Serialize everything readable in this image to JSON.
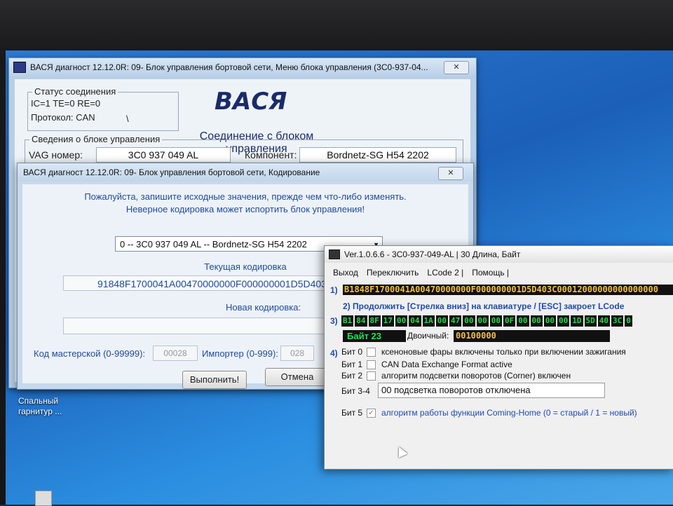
{
  "win1": {
    "title": "ВАСЯ диагност 12.12.0R: 09- Блок управления бортовой сети,  Меню блока управления (3C0-937-04...",
    "close": "✕",
    "status_group": "Статус соединения",
    "status_line": "IC=1  TE=0  RE=0",
    "protocol": "Протокол: CAN",
    "status_glyph": "\\",
    "brand": "ВАСЯ",
    "connection": "Соединение с блоком управления",
    "info_group": "Сведения о блоке управления",
    "vag_label": "VAG номер:",
    "vag_value": "3C0 937 049 AL",
    "component_label": "Компонент:",
    "component_value": "Bordnetz-SG     H54 2202"
  },
  "win2": {
    "title": "ВАСЯ диагност 12.12.0R: 09- Блок управления бортовой сети,  Кодирование",
    "close": "✕",
    "warning1": "Пожалуйста, запишите исходные значения, прежде чем что-либо изменять.",
    "warning2": "Неверное кодировка может испортить блок управления!",
    "combo_value": "0 -- 3C0 937 049 AL -- Bordnetz-SG     H54 2202",
    "current_label": "Текущая кодировка",
    "current_value": "91848F1700041A00470000000F000000001D5D403C0",
    "new_label": "Новая кодировка:",
    "workshop_label": "Код мастерской (0-99999):",
    "workshop_value": "00028",
    "importer_label": "Импортер (0-999):",
    "importer_value": "028",
    "execute": "Выполнить!",
    "cancel": "Отмена"
  },
  "win3": {
    "title": "Ver.1.0.6.6 -    3C0-937-049-AL | 30 Длина, Байт",
    "menu": [
      "Выход",
      "Переключить",
      "LCode 2 |",
      "Помощь |"
    ],
    "n1": "1)",
    "hex": "B1848F1700041A00470000000F000000001D5D403C00012000000000000000",
    "hint": "2) Продолжить [Стрелка вниз] на клавиатуре / [ESC] закроет LCode",
    "n3": "3)",
    "bytes": [
      "B1",
      "84",
      "8F",
      "17",
      "00",
      "04",
      "1A",
      "00",
      "47",
      "00",
      "00",
      "00",
      "0F",
      "00",
      "00",
      "00",
      "00",
      "1D",
      "5D",
      "40",
      "3C",
      "0"
    ],
    "byte_label": "Байт 23",
    "binary_label": "Двоичный:",
    "binary_value": "00100000",
    "n4": "4)",
    "bit0_label": "Бит 0",
    "bit0_text": "ксеноновые фары включены только при включении зажигания",
    "bit1_label": "Бит 1",
    "bit1_text": "CAN Data Exchange Format active",
    "bit2_label": "Бит 2",
    "bit2_text": "алгоритм подсветки поворотов (Corner) включен",
    "bit34_label": "Бит 3-4",
    "bit34_value": "00 подсветка поворотов отключена",
    "bit5_label": "Бит 5",
    "bit5_check": "✓",
    "bit5_text": "алгоритм работы функции Coming-Home (0 = старый / 1 = новый)"
  },
  "desktop": {
    "icon_label_1": "Спальный",
    "icon_label_2": "гарнитур ..."
  }
}
